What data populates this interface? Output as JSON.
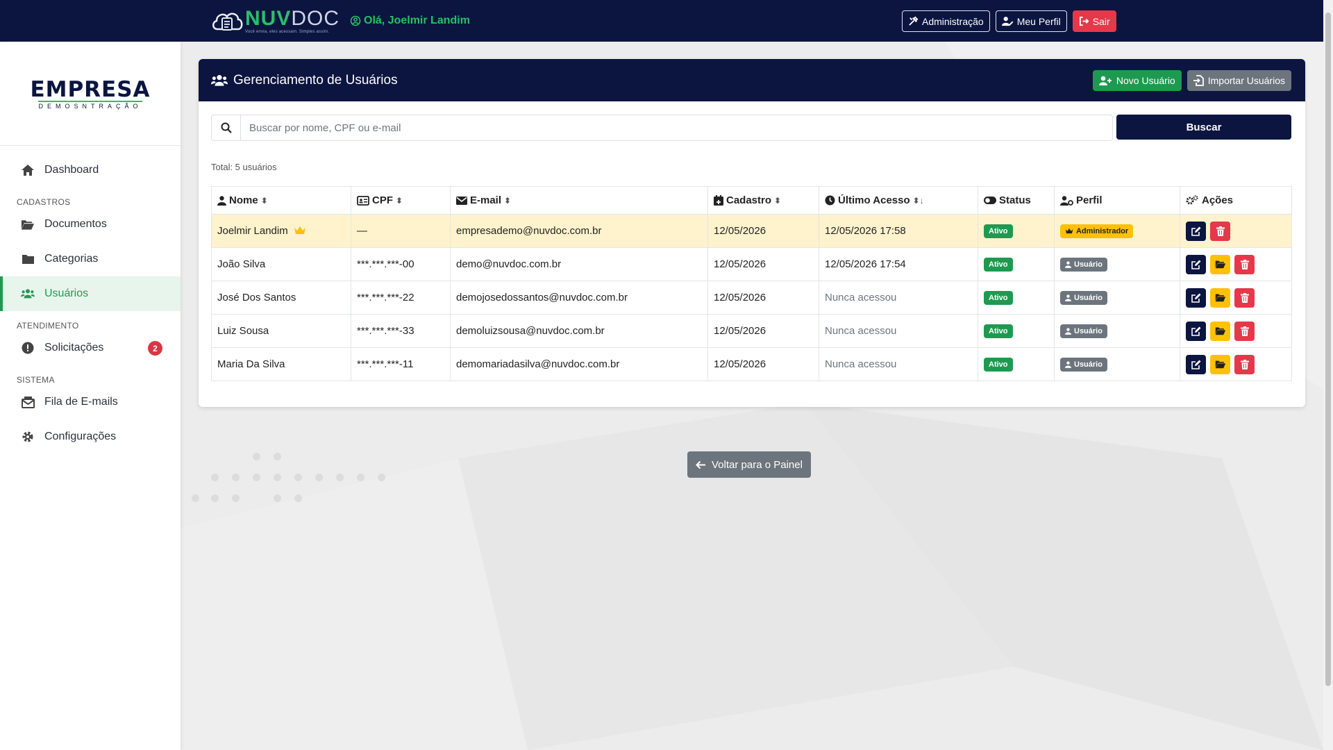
{
  "brand": {
    "nuv": "NUV",
    "doc": "DOC",
    "tagline": "Você envia, eles acessam. Simples assim."
  },
  "header": {
    "greeting": "Olá, Joelmir Landim",
    "buttons": {
      "admin": "Administração",
      "profile": "Meu Perfil",
      "logout": "Sair"
    }
  },
  "company": {
    "name": "EMPRESA",
    "subtitle": "DEMOSNTRAÇÃO"
  },
  "sidebar": {
    "dashboard": "Dashboard",
    "section_cadastros": "CADASTROS",
    "documentos": "Documentos",
    "categorias": "Categorias",
    "usuarios": "Usuários",
    "section_atendimento": "ATENDIMENTO",
    "solicitacoes": "Solicitações",
    "solicitacoes_count": "2",
    "section_sistema": "SISTEMA",
    "fila_emails": "Fila de E-mails",
    "configuracoes": "Configurações"
  },
  "card": {
    "title": "Gerenciamento de Usuários",
    "new_user": "Novo Usuário",
    "import_users": "Importar Usuários",
    "search_placeholder": "Buscar por nome, CPF ou e-mail",
    "search_button": "Buscar",
    "total": "Total: 5 usuários"
  },
  "table": {
    "headers": {
      "nome": "Nome",
      "cpf": "CPF",
      "email": "E-mail",
      "cadastro": "Cadastro",
      "ultimo": "Último Acesso",
      "status": "Status",
      "perfil": "Perfil",
      "acoes": "Ações"
    },
    "rows": [
      {
        "nome": "Joelmir Landim",
        "cpf": "—",
        "email": "empresademo@nuvdoc.com.br",
        "cadastro": "12/05/2026",
        "ultimo": "12/05/2026 17:58",
        "status": "Ativo",
        "perfil": "Administrador"
      },
      {
        "nome": "João Silva",
        "cpf": "***.***.***-00",
        "email": "demo@nuvdoc.com.br",
        "cadastro": "12/05/2026",
        "ultimo": "12/05/2026 17:54",
        "status": "Ativo",
        "perfil": "Usuário"
      },
      {
        "nome": "José Dos Santos",
        "cpf": "***.***.***-22",
        "email": "demojosedossantos@nuvdoc.com.br",
        "cadastro": "12/05/2026",
        "ultimo": "Nunca acessou",
        "status": "Ativo",
        "perfil": "Usuário"
      },
      {
        "nome": "Luiz Sousa",
        "cpf": "***.***.***-33",
        "email": "demoluizsousa@nuvdoc.com.br",
        "cadastro": "12/05/2026",
        "ultimo": "Nunca acessou",
        "status": "Ativo",
        "perfil": "Usuário"
      },
      {
        "nome": "Maria Da Silva",
        "cpf": "***.***.***-11",
        "email": "demomariadasilva@nuvdoc.com.br",
        "cadastro": "12/05/2026",
        "ultimo": "Nunca acessou",
        "status": "Ativo",
        "perfil": "Usuário"
      }
    ]
  },
  "back_button": "Voltar para o Painel",
  "colors": {
    "navy": "#0b1540",
    "green": "#1e9a50",
    "red": "#e5384a",
    "yellow": "#ffc107"
  }
}
